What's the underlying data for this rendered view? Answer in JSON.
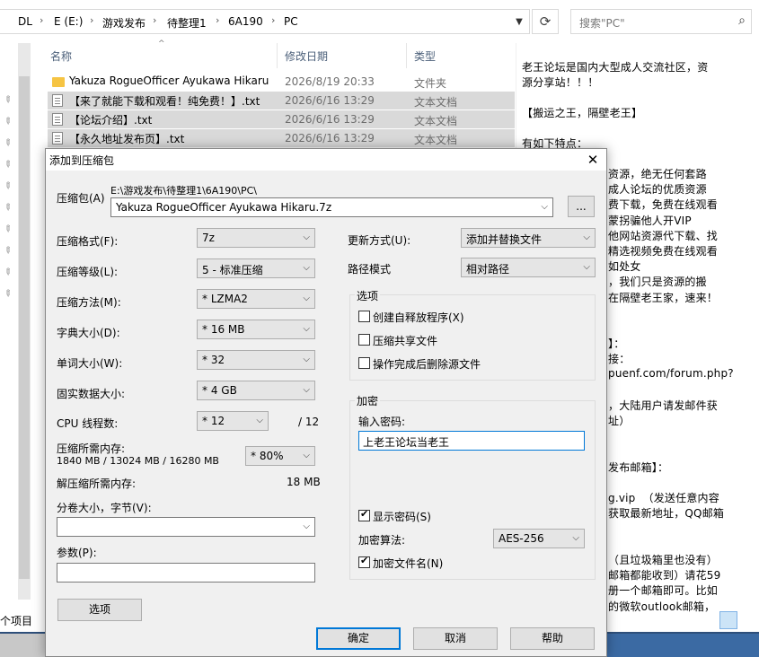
{
  "explorer": {
    "breadcrumb": [
      "DL",
      "E (E:)",
      "游戏发布",
      "待整理1",
      "6A190",
      "PC"
    ],
    "search_placeholder": "搜索\"PC\"",
    "columns": {
      "name": "名称",
      "date": "修改日期",
      "type": "类型"
    },
    "files": [
      {
        "name": "Yakuza RogueOfficer Ayukawa Hikaru",
        "date": "2026/8/19 20:33",
        "type": "文件夹",
        "icon": "folder",
        "selected": false
      },
      {
        "name": "【来了就能下载和观看！纯免费！】.txt",
        "date": "2026/6/16 13:29",
        "type": "文本文档",
        "icon": "txt",
        "selected": true
      },
      {
        "name": "【论坛介绍】.txt",
        "date": "2026/6/16 13:29",
        "type": "文本文档",
        "icon": "txt",
        "selected": true
      },
      {
        "name": "【永久地址发布页】.txt",
        "date": "2026/6/16 13:29",
        "type": "文本文档",
        "icon": "txt",
        "selected": true
      }
    ],
    "preview_lines_top": [
      "老王论坛是国内大型成人交流社区，资",
      "源分享站！！！",
      "",
      "【搬运之王，隔壁老王】",
      "",
      "有如下特点："
    ],
    "preview_lines_right": [
      "资源，绝无任何套路",
      "成人论坛的优质资源",
      "费下载，免费在线观看",
      "蒙拐骗他人开VIP",
      "他网站资源代下载、找",
      "精选视频免费在线观看",
      "如处女",
      "，我们只是资源的搬",
      "在隔壁老王家，速来！",
      "",
      "",
      "】：",
      "接：",
      "puenf.com/forum.php?",
      "",
      "，大陆用户请发邮件获",
      "址）",
      "",
      "",
      "发布邮箱】：",
      "",
      "g.vip  （发送任意内容",
      "获取最新地址，QQ邮箱",
      "",
      "",
      "（且垃圾箱里也没有）",
      "邮箱都能收到）请花59",
      "册一个邮箱即可。比如",
      "的微软outlook邮箱，"
    ],
    "status_items": "个项目"
  },
  "dialog": {
    "title": "添加到压缩包",
    "archive_label": "压缩包(A)",
    "archive_path": "E:\\游戏发布\\待整理1\\6A190\\PC\\",
    "archive_name": "Yakuza RogueOfficer Ayukawa Hikaru.7z",
    "browse_label": "...",
    "format_label": "压缩格式(F):",
    "format_value": "7z",
    "level_label": "压缩等级(L):",
    "level_value": "5 - 标准压缩",
    "method_label": "压缩方法(M):",
    "method_value": "* LZMA2",
    "dict_label": "字典大小(D):",
    "dict_value": "* 16 MB",
    "word_label": "单词大小(W):",
    "word_value": "* 32",
    "solid_label": "固实数据大小:",
    "solid_value": "* 4 GB",
    "cpu_label": "CPU 线程数:",
    "cpu_value": "* 12",
    "cpu_total": "/ 12",
    "mem_label": "压缩所需内存:",
    "mem_detail": "1840 MB / 13024 MB / 16280 MB",
    "mem_percent": "* 80%",
    "demem_label": "解压缩所需内存:",
    "demem_value": "18 MB",
    "volume_label": "分卷大小，字节(V):",
    "volume_value": "",
    "params_label": "参数(P):",
    "params_value": "",
    "options_button": "选项",
    "update_label": "更新方式(U):",
    "update_value": "添加并替换文件",
    "pathmode_label": "路径模式",
    "pathmode_value": "相对路径",
    "options_group": "选项",
    "opt_sfx": "创建自释放程序(X)",
    "opt_shared": "压缩共享文件",
    "opt_delete": "操作完成后删除源文件",
    "enc_group": "加密",
    "pwd_label": "输入密码:",
    "pwd_value": "上老王论坛当老王",
    "show_pwd": "显示密码(S)",
    "enc_method_label": "加密算法:",
    "enc_method_value": "AES-256",
    "enc_names": "加密文件名(N)",
    "ok": "确定",
    "cancel": "取消",
    "help": "帮助",
    "close_glyph": "✕"
  }
}
